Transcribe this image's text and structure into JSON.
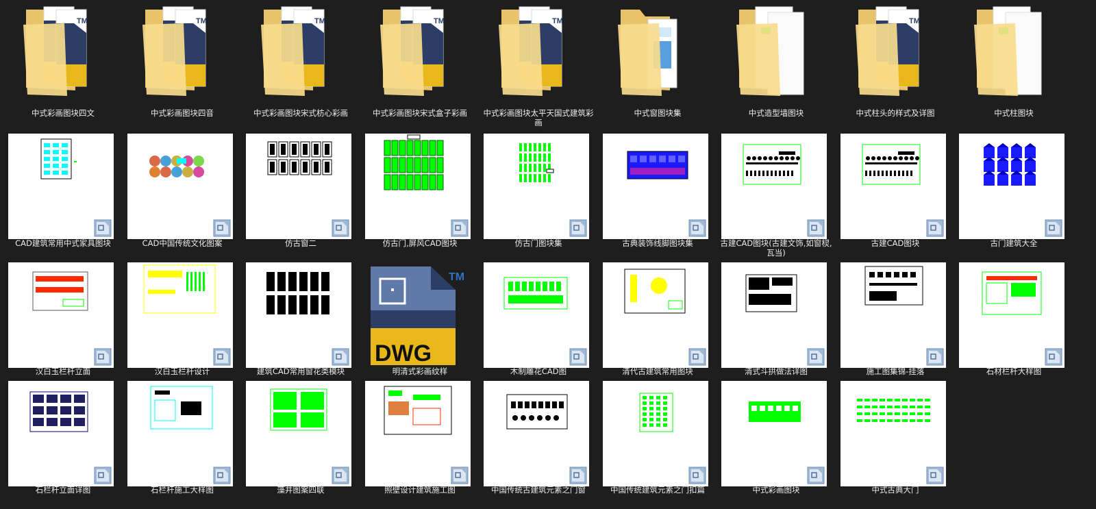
{
  "items": [
    {
      "label": "中式彩画图块四文",
      "kind": "folder",
      "variant": "dwg",
      "icon": "folder-dwg-icon"
    },
    {
      "label": "中式彩画图块四音",
      "kind": "folder",
      "variant": "dwg",
      "icon": "folder-dwg-icon"
    },
    {
      "label": "中式彩画图块宋式枋心彩画",
      "kind": "folder",
      "variant": "dwg",
      "icon": "folder-dwg-icon"
    },
    {
      "label": "中式彩画图块宋式盒子彩画",
      "kind": "folder",
      "variant": "dwg",
      "icon": "folder-dwg-icon"
    },
    {
      "label": "中式彩画图块太平天国式建筑彩画",
      "kind": "folder",
      "variant": "dwg",
      "icon": "folder-dwg-icon"
    },
    {
      "label": "中式窗图块集",
      "kind": "folder",
      "variant": "image",
      "icon": "folder-image-icon"
    },
    {
      "label": "中式造型墙图块",
      "kind": "folder",
      "variant": "paper",
      "icon": "folder-paper-icon"
    },
    {
      "label": "中式柱头的样式及详图",
      "kind": "folder",
      "variant": "dwg",
      "icon": "folder-dwg-icon"
    },
    {
      "label": "中式柱图块",
      "kind": "folder",
      "variant": "paper",
      "icon": "folder-paper-icon"
    },
    {
      "label": "CAD建筑常用中式家具图块",
      "kind": "thumb",
      "style": "cyan-grid"
    },
    {
      "label": "CAD中国传统文化图案",
      "kind": "thumb",
      "style": "color-medallions"
    },
    {
      "label": "仿古窗二",
      "kind": "thumb",
      "style": "black-windows"
    },
    {
      "label": "仿古门,屏风CAD图块",
      "kind": "thumb",
      "style": "green-dense"
    },
    {
      "label": "仿古门图块集",
      "kind": "thumb",
      "style": "green-columns"
    },
    {
      "label": "古典装饰线脚图块集",
      "kind": "thumb",
      "style": "blue-panel"
    },
    {
      "label": "古建CAD图块(古建文饰,如窗棂,瓦当)",
      "kind": "thumb",
      "style": "green-frame-rows"
    },
    {
      "label": "古建CAD图块",
      "kind": "thumb",
      "style": "green-frame-rows"
    },
    {
      "label": "古门建筑大全",
      "kind": "thumb",
      "style": "blue-gates"
    },
    {
      "label": "汉白玉栏杆立面",
      "kind": "thumb",
      "style": "red-balustrade"
    },
    {
      "label": "汉白玉栏杆设计",
      "kind": "thumb",
      "style": "yellow-railing"
    },
    {
      "label": "建筑CAD常用窗花类模块",
      "kind": "thumb",
      "style": "black-blocks"
    },
    {
      "label": "明清式彩画纹样",
      "kind": "dwgicon",
      "style": "dwg"
    },
    {
      "label": "木制雕花CAD图",
      "kind": "thumb",
      "style": "green-sheet"
    },
    {
      "label": "清代古建筑常用图块",
      "kind": "thumb",
      "style": "yellow-green-ornament"
    },
    {
      "label": "清式斗拱做法详图",
      "kind": "thumb",
      "style": "black-bracket"
    },
    {
      "label": "施工图集锦-挂落",
      "kind": "thumb",
      "style": "black-detail"
    },
    {
      "label": "石材栏杆大样图",
      "kind": "thumb",
      "style": "red-green-frame"
    },
    {
      "label": "石栏杆立面详图",
      "kind": "thumb",
      "style": "navy-grid"
    },
    {
      "label": "石栏杆施工大样图",
      "kind": "thumb",
      "style": "cyan-frame"
    },
    {
      "label": "藻井图案四联",
      "kind": "thumb",
      "style": "green-ceiling"
    },
    {
      "label": "照壁设计建筑施工图",
      "kind": "thumb",
      "style": "mixed-sheet"
    },
    {
      "label": "中国传统古建筑元素之门窗",
      "kind": "thumb",
      "style": "black-shapes"
    },
    {
      "label": "中国传统建筑元素之门扣篇",
      "kind": "thumb",
      "style": "green-tall"
    },
    {
      "label": "中式彩画图块",
      "kind": "thumb",
      "style": "green-blocks"
    },
    {
      "label": "中式古典大门",
      "kind": "thumb",
      "style": "green-text-rows"
    }
  ],
  "colors": {
    "background": "#1e1e1e",
    "cad_green": "#00ff00",
    "cad_blue": "#1a1aff",
    "cad_cyan": "#00ffff",
    "cad_red": "#ff2a00",
    "cad_yellow": "#ffff00",
    "dwg_gold": "#e8b81a",
    "dwg_navy": "#2c3e66",
    "folder": "#f5d98a"
  },
  "dwg_text": "DWG",
  "tm_text": "TM"
}
